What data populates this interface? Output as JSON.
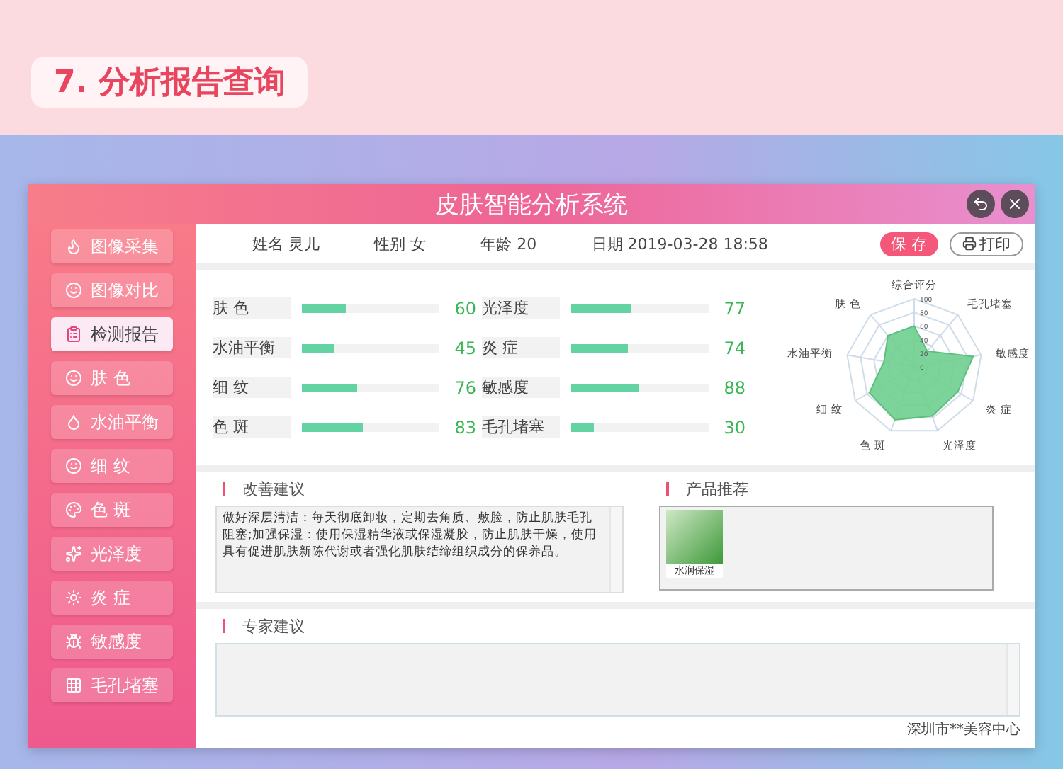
{
  "page_heading": "7. 分析报告查询",
  "window": {
    "title": "皮肤智能分析系统"
  },
  "sidebar": {
    "items": [
      {
        "label": "图像采集",
        "selected": false
      },
      {
        "label": "图像对比",
        "selected": false
      },
      {
        "label": "检测报告",
        "selected": true
      },
      {
        "label": "肤 色",
        "selected": false
      },
      {
        "label": "水油平衡",
        "selected": false
      },
      {
        "label": "细 纹",
        "selected": false
      },
      {
        "label": "色 斑",
        "selected": false
      },
      {
        "label": "光泽度",
        "selected": false
      },
      {
        "label": "炎 症",
        "selected": false
      },
      {
        "label": "敏感度",
        "selected": false
      },
      {
        "label": "毛孔堵塞",
        "selected": false
      }
    ]
  },
  "info": {
    "fields": [
      {
        "label": "姓名",
        "value": "灵儿"
      },
      {
        "label": "性别",
        "value": "女"
      },
      {
        "label": "年龄",
        "value": "20"
      },
      {
        "label": "日期",
        "value": "2019-03-28 18:58"
      }
    ],
    "buttons": [
      {
        "label": "保 存",
        "kind": "primary"
      },
      {
        "label": "打印",
        "kind": "print"
      }
    ]
  },
  "metrics": [
    {
      "name": "肤 色",
      "level": 0.32,
      "reading": "60"
    },
    {
      "name": "光泽度",
      "level": 0.43,
      "reading": "77"
    },
    {
      "name": "水油平衡",
      "level": 0.24,
      "reading": "45"
    },
    {
      "name": "炎 症",
      "level": 0.41,
      "reading": "74"
    },
    {
      "name": "细 纹",
      "level": 0.4,
      "reading": "76"
    },
    {
      "name": "敏感度",
      "level": 0.49,
      "reading": "88"
    },
    {
      "name": "色 斑",
      "level": 0.44,
      "reading": "83"
    },
    {
      "name": "毛孔堵塞",
      "level": 0.17,
      "reading": "30"
    }
  ],
  "radar": {
    "axis_labels": [
      "综合评分",
      "毛孔堵塞",
      "敏感度",
      "炎 症",
      "光泽度",
      "色 斑",
      "细 纹",
      "水油平衡",
      "肤 色"
    ],
    "tick_labels": [
      "100",
      "80",
      "60",
      "40",
      "20",
      "0"
    ]
  },
  "advice": {
    "title": "改善建议",
    "text": "做好深层清洁：每天彻底卸妆，定期去角质、敷脸，防止肌肤毛孔阻塞;加强保湿：使用保湿精华液或保湿凝胶，防止肌肤干燥，使用具有促进肌肤新陈代谢或者强化肌肤结缔组织成分的保养品。"
  },
  "products": {
    "title": "产品推荐",
    "items": [
      {
        "name": "水润保湿"
      }
    ]
  },
  "expert": {
    "title": "专家建议"
  },
  "footer": "深圳市**美容中心"
}
